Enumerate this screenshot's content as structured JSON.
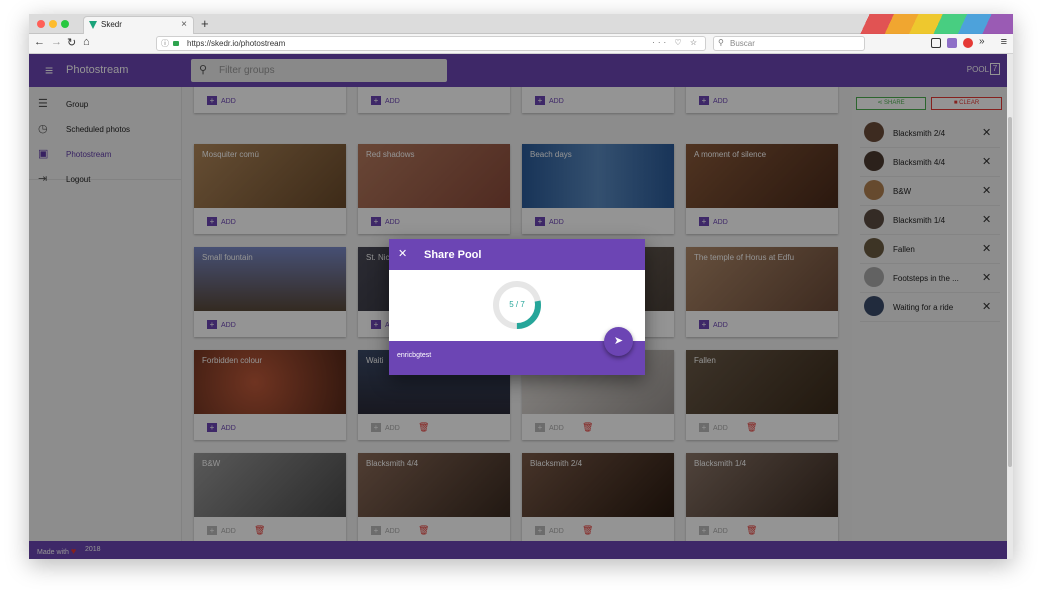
{
  "browser": {
    "tab_title": "Skedr",
    "tab_close": "×",
    "new_tab": "+",
    "url": "https://skedr.io/photostream",
    "search_placeholder": "Buscar"
  },
  "app": {
    "title": "Photostream",
    "filter_placeholder": "Filter groups",
    "pool_label": "POOL",
    "pool_count": "7"
  },
  "sidebar": {
    "items": [
      {
        "label": "Group",
        "icon": "list-icon"
      },
      {
        "label": "Scheduled photos",
        "icon": "clock-icon"
      },
      {
        "label": "Photostream",
        "icon": "photo-icon"
      },
      {
        "label": "Logout",
        "icon": "logout-icon"
      }
    ]
  },
  "grid": {
    "add_label": "ADD",
    "cards": [
      {
        "title": "Mosquiter comú",
        "color": "#a07a4a"
      },
      {
        "title": "Red shadows",
        "color": "#a46a4e"
      },
      {
        "title": "Beach days",
        "color": "#3a6aa8"
      },
      {
        "title": "A moment of silence",
        "color": "#7a4a2a"
      },
      {
        "title": "Small fountain",
        "color": "#6a7ab0"
      },
      {
        "title": "St. Nic",
        "color": "#3a3a48"
      },
      {
        "title": "",
        "color": "#6a6058"
      },
      {
        "title": "The temple of Horus at Edfu",
        "color": "#9a7a60"
      },
      {
        "title": "Forbidden colour",
        "color": "#7a4030"
      },
      {
        "title": "Waiti",
        "color": "#3a4058"
      },
      {
        "title": "",
        "color": "#d8d4d0"
      },
      {
        "title": "Fallen",
        "color": "#5a4a3a"
      },
      {
        "title": "B&W",
        "color": "#7a7a7a"
      },
      {
        "title": "Blacksmith 4/4",
        "color": "#6a4a38"
      },
      {
        "title": "Blacksmith 2/4",
        "color": "#5a4030"
      },
      {
        "title": "Blacksmith 1/4",
        "color": "#6a5548"
      }
    ]
  },
  "pool_panel": {
    "share_label": "SHARE",
    "clear_label": "CLEAR",
    "items": [
      "Blacksmith 2/4",
      "Blacksmith 4/4",
      "B&W",
      "Blacksmith 1/4",
      "Fallen",
      "Footsteps in the ...",
      "Waiting for a ride"
    ]
  },
  "dialog": {
    "title": "Share Pool",
    "progress_text": "5 / 7",
    "progress_done": 5,
    "progress_total": 7,
    "username": "enricbgtest"
  },
  "footer": {
    "made_with": "Made with",
    "year": "2018"
  },
  "colors": {
    "primary": "#6c45b4",
    "teal": "#26a69a",
    "danger": "#e53935",
    "success": "#4caf50"
  }
}
